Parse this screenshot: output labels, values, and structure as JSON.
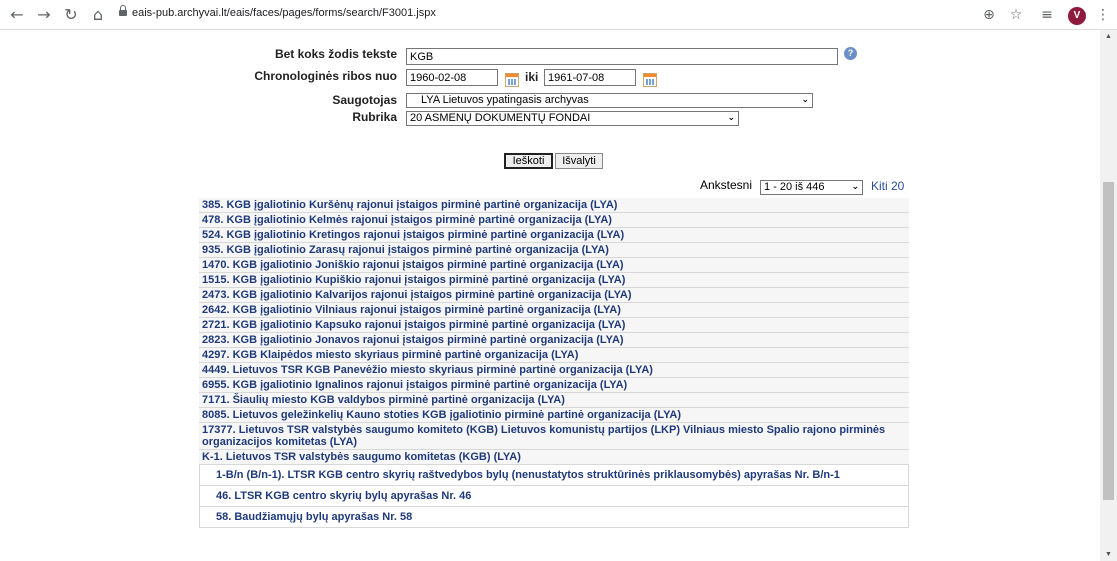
{
  "browser": {
    "url": "eais-pub.archyvai.lt/eais/faces/pages/forms/search/F3001.jspx",
    "avatar_letter": "V",
    "icons": [
      "back-icon",
      "forward-icon",
      "reload-icon",
      "home-icon",
      "lock-icon",
      "zoom-icon",
      "star-icon",
      "reading-list-icon",
      "menu-icon"
    ]
  },
  "form": {
    "keyword_label": "Bet koks žodis tekste",
    "keyword_value": "KGB",
    "chrono_label": "Chronologinės ribos nuo",
    "date_from": "1960-02-08",
    "iki_label": "iki",
    "date_to": "1961-07-08",
    "saugotojas_label": "Saugotojas",
    "saugotojas_value": "LYA Lietuvos ypatingasis archyvas",
    "rubrika_label": "Rubrika",
    "rubrika_value": "20 ASMENŲ DOKUMENTŲ FONDAI",
    "search_button": "Ieškoti",
    "clear_button": "Išvalyti"
  },
  "pager": {
    "prev_label": "Ankstesni",
    "range_value": "1 - 20 iš 446",
    "next_label": "Kiti 20"
  },
  "results": [
    {
      "text": "385. KGB įgaliotinio Kuršėnų rajonui įstaigos pirminė partinė organizacija (LYA)",
      "sub": false
    },
    {
      "text": "478. KGB įgaliotinio Kelmės rajonui įstaigos pirminė partinė organizacija (LYA)",
      "sub": false
    },
    {
      "text": "524. KGB įgaliotinio Kretingos rajonui įstaigos pirminė partinė organizacija (LYA)",
      "sub": false
    },
    {
      "text": "935. KGB įgaliotinio Zarasų rajonui įstaigos pirminė partinė organizacija (LYA)",
      "sub": false
    },
    {
      "text": "1470. KGB įgaliotinio Joniškio rajonui įstaigos pirminė partinė organizacija (LYA)",
      "sub": false
    },
    {
      "text": "1515. KGB įgaliotinio Kupiškio rajonui įstaigos pirminė partinė organizacija (LYA)",
      "sub": false
    },
    {
      "text": "2473. KGB įgaliotinio Kalvarijos rajonui įstaigos pirminė partinė organizacija (LYA)",
      "sub": false
    },
    {
      "text": "2642. KGB įgaliotinio Vilniaus rajonui įstaigos pirminė partinė organizacija (LYA)",
      "sub": false
    },
    {
      "text": "2721. KGB įgaliotinio Kapsuko rajonui įstaigos pirminė partinė organizacija (LYA)",
      "sub": false
    },
    {
      "text": "2823. KGB įgaliotinio Jonavos rajonui įstaigos pirminė partinė organizacija (LYA)",
      "sub": false
    },
    {
      "text": "4297. KGB Klaipėdos miesto skyriaus pirminė partinė organizacija (LYA)",
      "sub": false
    },
    {
      "text": "4449. Lietuvos TSR KGB Panevėžio miesto skyriaus pirminė partinė organizacija (LYA)",
      "sub": false
    },
    {
      "text": "6955. KGB įgaliotinio Ignalinos rajonui įstaigos pirminė partinė organizacija (LYA)",
      "sub": false
    },
    {
      "text": "7171. Šiaulių miesto KGB valdybos pirminė partinė organizacija (LYA)",
      "sub": false
    },
    {
      "text": "8085. Lietuvos geležinkelių Kauno stoties KGB įgaliotinio pirminė partinė organizacija (LYA)",
      "sub": false
    },
    {
      "text": "17377. Lietuvos TSR valstybės saugumo komiteto (KGB) Lietuvos komunistų partijos (LKP) Vilniaus miesto Spalio rajono pirminės organizacijos komitetas (LYA)",
      "sub": false
    },
    {
      "text": "K-1. Lietuvos TSR valstybės saugumo komitetas (KGB) (LYA)",
      "sub": false
    },
    {
      "text": "1-B/n (B/n-1). LTSR KGB centro skyrių raštvedybos bylų (nenustatytos struktūrinės priklausomybės) apyrašas Nr. B/n-1",
      "sub": true
    },
    {
      "text": "46. LTSR KGB centro skyrių bylų apyrašas Nr. 46",
      "sub": true
    },
    {
      "text": "58. Baudžiamųjų bylų apyrašas Nr. 58",
      "sub": true
    }
  ]
}
